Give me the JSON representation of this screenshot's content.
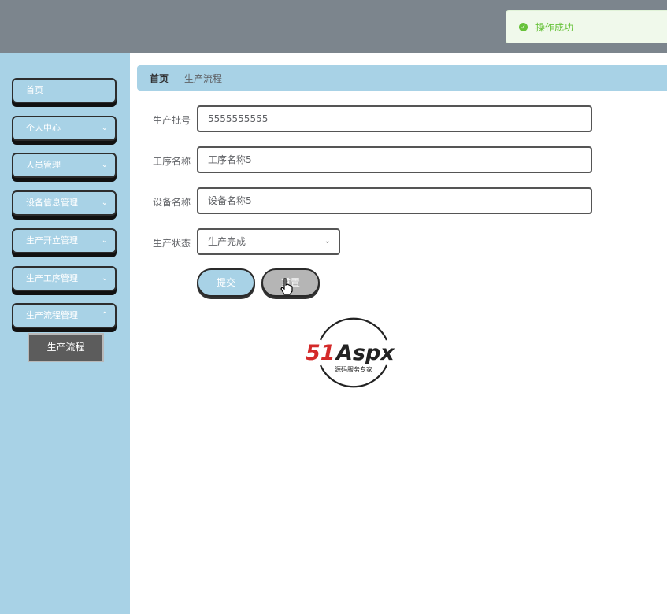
{
  "toast": {
    "icon": "check-circle-icon",
    "message": "操作成功"
  },
  "sidebar": {
    "items": [
      {
        "label": "首页",
        "has_chevron": false
      },
      {
        "label": "个人中心",
        "has_chevron": true
      },
      {
        "label": "人员管理",
        "has_chevron": true
      },
      {
        "label": "设备信息管理",
        "has_chevron": true
      },
      {
        "label": "生产开立管理",
        "has_chevron": true
      },
      {
        "label": "生产工序管理",
        "has_chevron": true
      },
      {
        "label": "生产流程管理",
        "has_chevron": true
      }
    ],
    "sub_item": {
      "label": "生产流程"
    }
  },
  "breadcrumb": {
    "home": "首页",
    "current": "生产流程"
  },
  "form": {
    "batch_label": "生产批号",
    "batch_value": "5555555555",
    "process_label": "工序名称",
    "process_value": "工序名称5",
    "device_label": "设备名称",
    "device_value": "设备名称5",
    "status_label": "生产状态",
    "status_value": "生产完成",
    "submit_label": "提交",
    "reset_label": "重置"
  },
  "watermark": {
    "brand": "51Aspx",
    "tagline": "源码服务专家"
  },
  "colors": {
    "sidebar": "#a8d2e6",
    "topbar": "#7c858d",
    "success": "#67c23a",
    "brand_red": "#d42a2a",
    "brand_green": "#2e9e3e"
  }
}
